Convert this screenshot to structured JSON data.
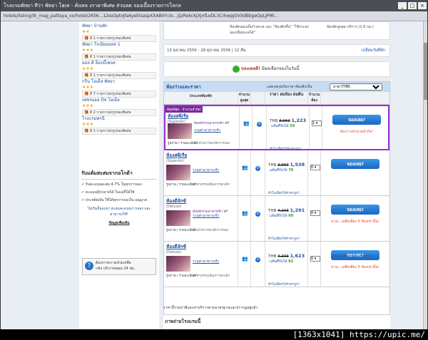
{
  "window": {
    "title": "โรงแรมพัทยา ทีว่า พัทยา โฮเท - ค้นหล งราคาพิเศษ ส่วนลด จองเบื้องรายการโลกล"
  },
  "url": "hotels/listing/th_mag_pattaya_xx/hotel/2656...12ssOptoJfaKyeEisaspXXAB0Yclo...jQ/RokcKjXjnfLoDL3CrhwpJGVXdBbgeOpLJPMl...",
  "topbox": {
    "col1": "ห้องพักมองเห็นวิวทะเล และ \"ห้องพักชั้น\" \"ใช้กระจกมองเห็นทะเลได้\"",
    "col2": "ห้องพักสูงสุด บริการ (1.6 กม.)"
  },
  "datebar": {
    "text": "15 ตุลาคม 2556 - 28 ตุลาคม 2556 | 12 คืน",
    "change": "เปลี่ยนวันที่พัก"
  },
  "goodprice": {
    "prefix": "ของเคยดี!",
    "text": "มีผลเลือกจองในวันนี้"
  },
  "sidebar": {
    "hotels": [
      {
        "name": "พัทยา บ้านพัก",
        "stars": "★★",
        "deal": "ดี 1 รายการส่งรูปจองพิเศษ"
      },
      {
        "name": "พัทยา โรเมียมพลส 1",
        "stars": "★★★",
        "deal": "ดี 1 รายการส่งรูปจองพิเศษ"
      },
      {
        "name": "ออล ดี ล็อบบี้เพลส",
        "stars": "★★★",
        "deal": "ดี 1 รายการส่งรูปจองพิเศษ"
      },
      {
        "name": "กรีน โฮเต็ล พัทยา",
        "stars": "★★★",
        "deal": "ดี 7 รายการส่งรูปจองพิเศษ"
      },
      {
        "name": "เพชรมอล บีช โฮเต็ล",
        "stars": "★★★",
        "deal": "ดี 2 รายการส่งรูปจองพิเศษ"
      },
      {
        "name": "โรงแรมพรนี",
        "stars": "★★★",
        "deal": "ดี 1 รายการส่งรูปจองพิเศษ"
      }
    ],
    "member": {
      "title": "รับแต้มสะสมจากอโกด้า",
      "items": [
        "รับคะแนนสะสม 4.7% ในทุกการจอง",
        "คะแนนบุ๊กกลายได้ ในแม่ปีได้ใช้",
        "ประหยัดเงิน ใช้ได้ทุกการจองใน อนุญาต"
      ],
      "promo": "ไปเริ่มลั้นแถม! สะสมคะแนนการจอง และ สามารถใช้!",
      "link": "ข้อมูลเพิ่มเติม"
    },
    "call": {
      "title": "ต้องการความช่วยเหลือ",
      "text": "กลับ บริการตลอด 24 ชม."
    }
  },
  "rooms": {
    "title": "ห้องว่างและราคา",
    "currency_label": "แสดงสกุลเงินราคาห้องพักเป็น",
    "currency_value": "บาท (THB)",
    "columns": [
      "ประเภทห้องพัก",
      "จำนวน สูงสุด",
      "",
      "ราคา ต่อห้อง ต่อคืน",
      "จำนวน ห้อง",
      ""
    ],
    "items": [
      {
        "best": "ดีสุดที่สุด - จำนวนจำกัด!",
        "name": "ห้องสุพีเรีย",
        "type": "(Superior)",
        "promo": "ห้องพักรวมอาหารเช้า ฟรี",
        "promo2": "รวมค่าอาหารเช้า",
        "thumb_link": "รูปภาพ / รายละเอียด",
        "breakfast": "เงื่อนไขการยกเลิกการจอง",
        "persons": "2",
        "old": "3,963",
        "new": "1,223",
        "pts_label": "แต้มที่รับได้",
        "pts": "59",
        "cond": "ทำไมเลือกได้ราคาถูก?",
        "qty": "1",
        "book": "จองเลย!",
        "note": "ห้องว่างจำนวนจำกัด!"
      },
      {
        "best": "",
        "name": "ห้องสุพีเรีย",
        "type": "(Superior)",
        "promo": "",
        "promo2": "รวมค่าอาหารเช้า",
        "thumb_link": "รูปภาพ / รายละเอียด",
        "breakfast": "ฟรีค่าธรรมเนียมการยกเลิก",
        "persons": "2",
        "old": "3,963",
        "new": "1,538",
        "pts_label": "แต้มที่รับได้",
        "pts": "70",
        "cond": "ทำไมเลือกได้ราคาถูก?",
        "qty": "0",
        "book": "จองเลย!",
        "note": ""
      },
      {
        "best": "",
        "name": "ห้องดีลักซ์",
        "type": "(Deluxe)",
        "promo": "ห้องพักรวมอาหารเช้า ฟรี",
        "promo2": "รวมค่าอาหารเช้า",
        "thumb_link": "รูปภาพ / รายละเอียด",
        "breakfast": "เงื่อนไขการยกเลิกการจอง",
        "persons": "2",
        "old": "4,203",
        "new": "1,291",
        "pts_label": "แต้มที่รับได้",
        "pts": "60",
        "cond": "ทำไมเลือกได้ราคาถูก?",
        "qty": "0",
        "book": "จองเลย!",
        "note": "ด่วน...เหลือเพียง 5 ห้องเท่านั้น!"
      },
      {
        "best": "",
        "name": "ห้องดีลักซ์",
        "type": "(Deluxe)",
        "promo": "",
        "promo2": "รวมค่าอาหารเช้า",
        "thumb_link": "รูปภาพ / รายละเอียด",
        "breakfast": "ฟรีค่าธรรมเนียมการยกเลิก",
        "persons": "2",
        "old": "4,203",
        "new": "1,623",
        "pts_label": "แต้มที่รับได้",
        "pts": "82",
        "cond": "ทำไมเลือกได้ราคาถูก?",
        "qty": "0",
        "book": "จองเลย!",
        "note": "ด่วน...เหลือเพียง 5 ห้องเท่านั้น!"
      }
    ],
    "footer_q": "มีรีหน้าที่ประหยัดกรีมการ?",
    "footnote": "ราคานี้รวมภาษีและค่าบริการตามมาตรฐานและปรากฏอยู่แล้ว",
    "photos_title": "ภาพถ่ายโรงแรมนี้"
  },
  "watermark": "[1363x1041] https://upic.me/",
  "colors": {
    "accent": "#1d4fa0",
    "highlight": "#9933cc",
    "book": "#1a66c4",
    "alert": "#e04030"
  }
}
